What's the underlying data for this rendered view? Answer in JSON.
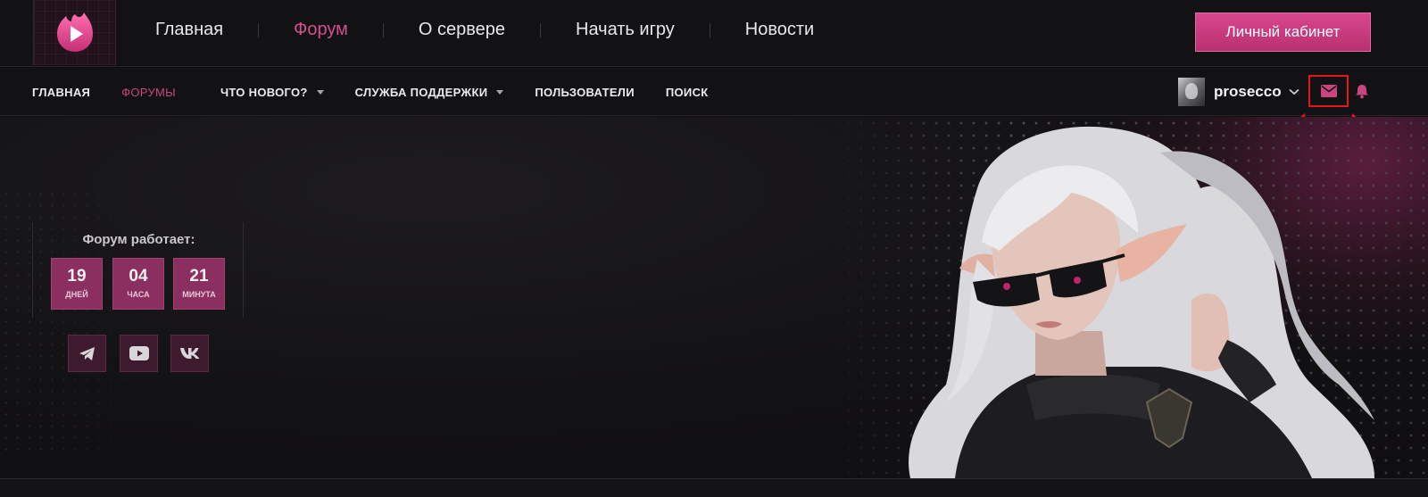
{
  "header": {
    "nav": [
      "Главная",
      "Форум",
      "О сервере",
      "Начать игру",
      "Новости"
    ],
    "active_nav": "Форум",
    "cabinet_label": "Личный кабинет"
  },
  "subnav": {
    "links": [
      "ГЛАВНАЯ",
      "ФОРУМЫ",
      "ЧТО НОВОГО?",
      "СЛУЖБА ПОДДЕРЖКИ",
      "ПОЛЬЗОВАТЕЛИ",
      "ПОИСК"
    ],
    "active": "ФОРУМЫ"
  },
  "user": {
    "name": "prosecco"
  },
  "uptime": {
    "title": "Форум работает:",
    "days": {
      "value": "19",
      "label": "ДНЕЙ"
    },
    "hours": {
      "value": "04",
      "label": "ЧАСА"
    },
    "minutes": {
      "value": "21",
      "label": "МИНУТА"
    }
  },
  "icons": {
    "logo": "play-flame-logo-icon",
    "mail": "mail-icon",
    "bell": "bell-icon",
    "social": [
      "telegram-icon",
      "youtube-icon",
      "vk-icon"
    ]
  },
  "colors": {
    "accent": "#d44f8f",
    "button": "#c43b7d",
    "counter_bg": "#8b2f60",
    "highlight_box": "#e8141c"
  }
}
